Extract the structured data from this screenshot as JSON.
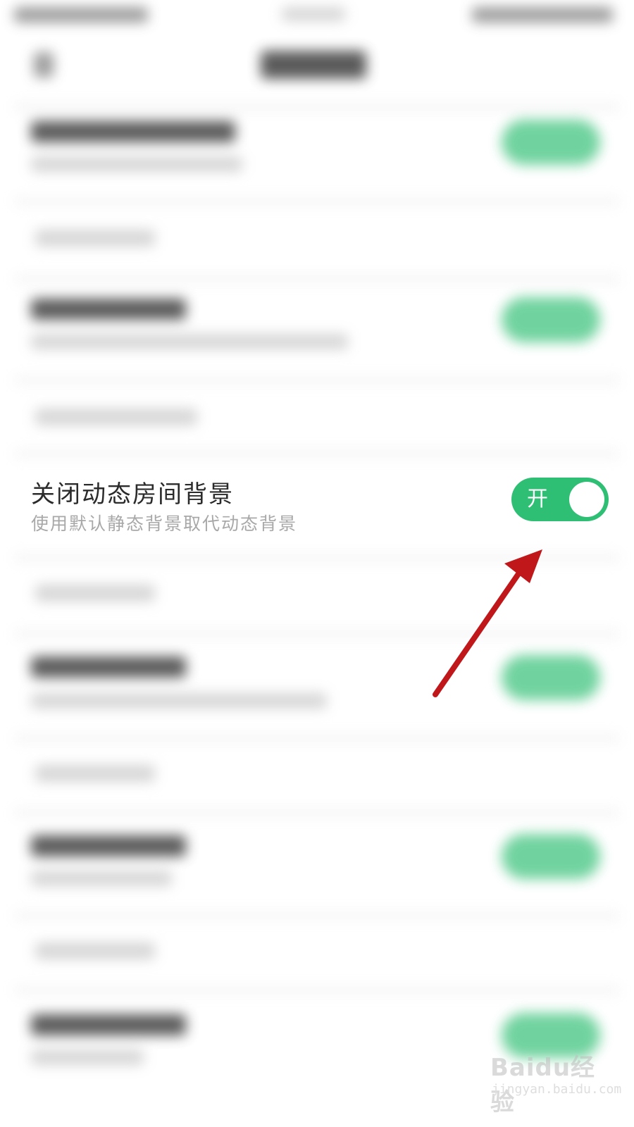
{
  "setting": {
    "title": "关闭动态房间背景",
    "subtitle": "使用默认静态背景取代动态背景",
    "toggle_label": "开",
    "toggle_state": "on"
  },
  "colors": {
    "toggle_on": "#2fbf74",
    "annotation_arrow": "#c0171b"
  },
  "watermark": {
    "brand": "Baidu经验",
    "url": "jingyan.baidu.com"
  }
}
